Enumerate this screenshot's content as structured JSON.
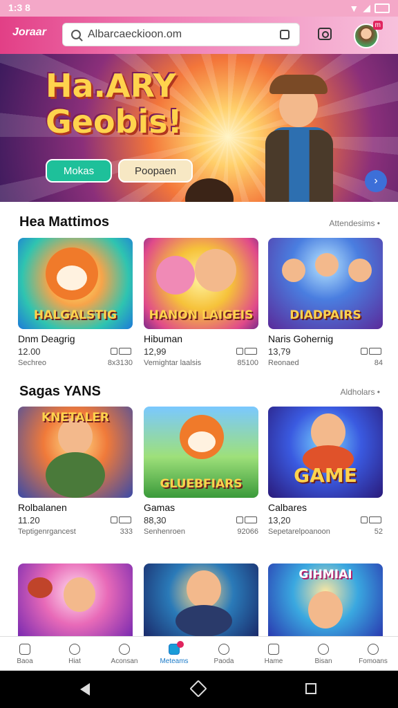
{
  "status": {
    "time": "1:3 8"
  },
  "header": {
    "logo": "Joraar",
    "search_value": "Albarcaeckioon.om"
  },
  "hero": {
    "title_line1": "Ha.ARY",
    "title_line2": "Geobis!",
    "primary_button": "Mokas",
    "secondary_button": "Poopaen"
  },
  "section1": {
    "title": "Hea Mattimos",
    "link": "Attendesims •",
    "cards": [
      {
        "thumb_label": "HALGALSTIG",
        "name": "Dnm Deagrig",
        "price": "12.00",
        "sub_left": "Sechreo",
        "sub_right": "8x3130"
      },
      {
        "thumb_label": "HANON LAIGEIS",
        "name": "Hibuman",
        "price": "12,99",
        "sub_left": "Vemightar laalsis",
        "sub_right": "85100"
      },
      {
        "thumb_label": "DIADPAIRS",
        "name": "Naris Gohernig",
        "price": "13,79",
        "sub_left": "Reonaed",
        "sub_right": "84"
      }
    ]
  },
  "section2": {
    "title": "Sagas YANS",
    "link": "Aldholars •",
    "cards": [
      {
        "thumb_label": "KNETALER",
        "name": "Rolbalanen",
        "price": "11.20",
        "sub_left": "Teptigenrgancest",
        "sub_right": "333"
      },
      {
        "thumb_label": "GLUEBFIARS",
        "name": "Gamas",
        "price": "88,30",
        "sub_left": "Senhenroen",
        "sub_right": "92066"
      },
      {
        "thumb_label": "GAME",
        "name": "Calbares",
        "price": "13,20",
        "sub_left": "Sepetarelpoanoon",
        "sub_right": "52"
      }
    ]
  },
  "section3": {
    "cards": [
      {
        "thumb_label": ""
      },
      {
        "thumb_label": ""
      },
      {
        "thumb_label": "GIHMIAI"
      }
    ]
  },
  "bottom_nav": {
    "items": [
      "Baoa",
      "Hiat",
      "Aconsan",
      "Meteams",
      "Paoda",
      "Hame",
      "Bisan",
      "Fomoans"
    ],
    "active": "Meteams"
  }
}
